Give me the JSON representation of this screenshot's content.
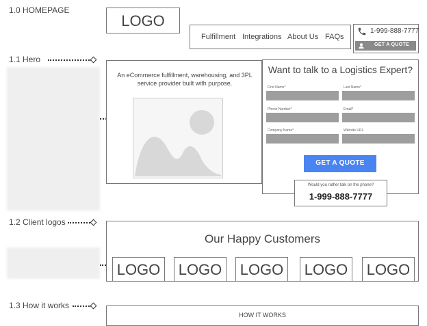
{
  "page": {
    "title": "1.0 HOMEPAGE"
  },
  "sections": {
    "hero": "1.1 Hero",
    "clients": "1.2 Client logos",
    "how": "1.3 How it works"
  },
  "header": {
    "logo": "LOGO",
    "nav": [
      "Fulfillment",
      "Integrations",
      "About Us",
      "FAQs"
    ],
    "phone": "1-999-888-7777",
    "quote_button": "GET A QUOTE"
  },
  "hero": {
    "tagline": "An eCommerce fulfillment, warehousing, and 3PL service provider built with purpose.",
    "form_title": "Want to talk to a Logistics Expert?",
    "fields": {
      "first_name": "First Name*",
      "last_name": "Last Name*",
      "phone": "Phone Number*",
      "email": "Email*",
      "company": "Company Name*",
      "website": "Website URL"
    },
    "submit": "GET A QUOTE",
    "phone_prompt": "Would you rather talk on the phone?",
    "phone_number": "1-999-888-7777"
  },
  "clients": {
    "title": "Our Happy Customers",
    "logos": [
      "LOGO",
      "LOGO",
      "LOGO",
      "LOGO",
      "LOGO"
    ]
  },
  "how": {
    "title": "HOW IT WORKS"
  },
  "colors": {
    "accent_blue": "#4a84f0",
    "field_gray": "#9e9e9e",
    "button_dark": "#8a8a8a"
  }
}
